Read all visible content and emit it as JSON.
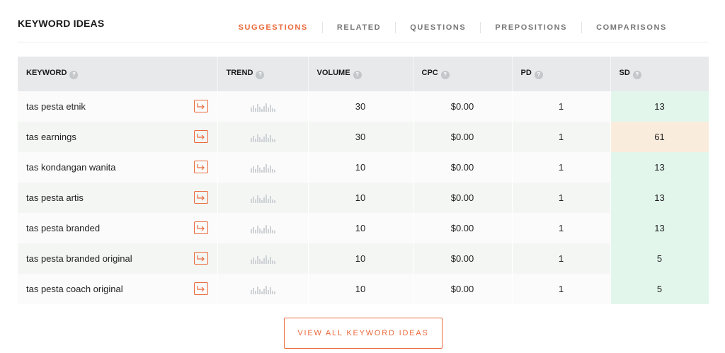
{
  "header": {
    "title": "KEYWORD IDEAS",
    "tabs": [
      {
        "label": "SUGGESTIONS",
        "active": true
      },
      {
        "label": "RELATED",
        "active": false
      },
      {
        "label": "QUESTIONS",
        "active": false
      },
      {
        "label": "PREPOSITIONS",
        "active": false
      },
      {
        "label": "COMPARISONS",
        "active": false
      }
    ]
  },
  "table": {
    "columns": [
      "KEYWORD",
      "TREND",
      "VOLUME",
      "CPC",
      "PD",
      "SD"
    ],
    "help_glyph": "?",
    "rows": [
      {
        "keyword": "tas pesta etnik",
        "volume": "30",
        "cpc": "$0.00",
        "pd": "1",
        "sd": "13",
        "sd_level": "low"
      },
      {
        "keyword": "tas earnings",
        "volume": "30",
        "cpc": "$0.00",
        "pd": "1",
        "sd": "61",
        "sd_level": "mid"
      },
      {
        "keyword": "tas kondangan wanita",
        "volume": "10",
        "cpc": "$0.00",
        "pd": "1",
        "sd": "13",
        "sd_level": "low"
      },
      {
        "keyword": "tas pesta artis",
        "volume": "10",
        "cpc": "$0.00",
        "pd": "1",
        "sd": "13",
        "sd_level": "low"
      },
      {
        "keyword": "tas pesta branded",
        "volume": "10",
        "cpc": "$0.00",
        "pd": "1",
        "sd": "13",
        "sd_level": "low"
      },
      {
        "keyword": "tas pesta branded original",
        "volume": "10",
        "cpc": "$0.00",
        "pd": "1",
        "sd": "5",
        "sd_level": "low"
      },
      {
        "keyword": "tas pesta coach original",
        "volume": "10",
        "cpc": "$0.00",
        "pd": "1",
        "sd": "5",
        "sd_level": "low"
      }
    ]
  },
  "footer": {
    "view_all_label": "VIEW ALL KEYWORD IDEAS"
  },
  "colors": {
    "accent": "#ea6a3c",
    "sd_low": "#e2f6ec",
    "sd_mid": "#faecdc",
    "header_bg": "#e7e9eb"
  },
  "icons": {
    "row_action": "external-arrow-icon",
    "trend": "trend-bars-icon",
    "help": "help-icon"
  }
}
